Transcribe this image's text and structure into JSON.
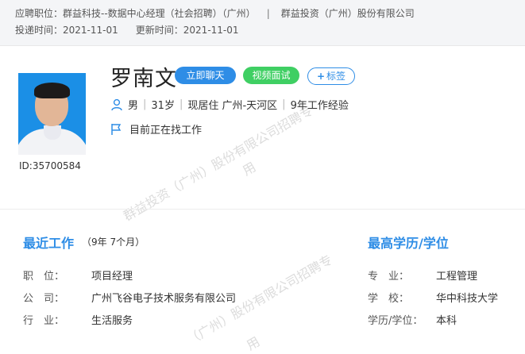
{
  "header": {
    "position_label": "应聘职位：",
    "position_value": "群益科技--数据中心经理（社会招聘）（广州）",
    "separator": "|",
    "company": "群益投资（广州）股份有限公司",
    "submit_label": "投递时间：",
    "submit_date": "2021-11-01",
    "update_label": "更新时间：",
    "update_date": "2021-11-01"
  },
  "candidate": {
    "name": "罗南文",
    "id_text": "ID:35700584",
    "gender": "男",
    "age": "31岁",
    "residence": "现居住 广州-天河区",
    "experience": "9年工作经验",
    "status": "目前正在找工作"
  },
  "actions": {
    "chat_label": "立即聊天",
    "video_label": "视频面试",
    "tag_plus": "+",
    "tag_label": "标签"
  },
  "watermark": {
    "line1": "群益投资（广州）股份有限公司招聘专",
    "line1_end": "用",
    "line2": "（广州）股份有限公司招聘专",
    "line2_end": "用"
  },
  "recent_work": {
    "title": "最近工作",
    "duration": "（9年 7个月）",
    "rows": [
      {
        "label": "职　位：",
        "value": "项目经理"
      },
      {
        "label": "公　司：",
        "value": "广州飞谷电子技术服务有限公司"
      },
      {
        "label": "行　业：",
        "value": "生活服务"
      }
    ]
  },
  "education": {
    "title": "最高学历/学位",
    "rows": [
      {
        "label": "专　业：",
        "value": "工程管理"
      },
      {
        "label": "学　校：",
        "value": "华中科技大学"
      },
      {
        "label": "学历/学位：",
        "value": "本科"
      }
    ]
  },
  "colors": {
    "accent": "#2e8de6",
    "video": "#3fcf63",
    "photo_bg": "#1b8fe6"
  }
}
